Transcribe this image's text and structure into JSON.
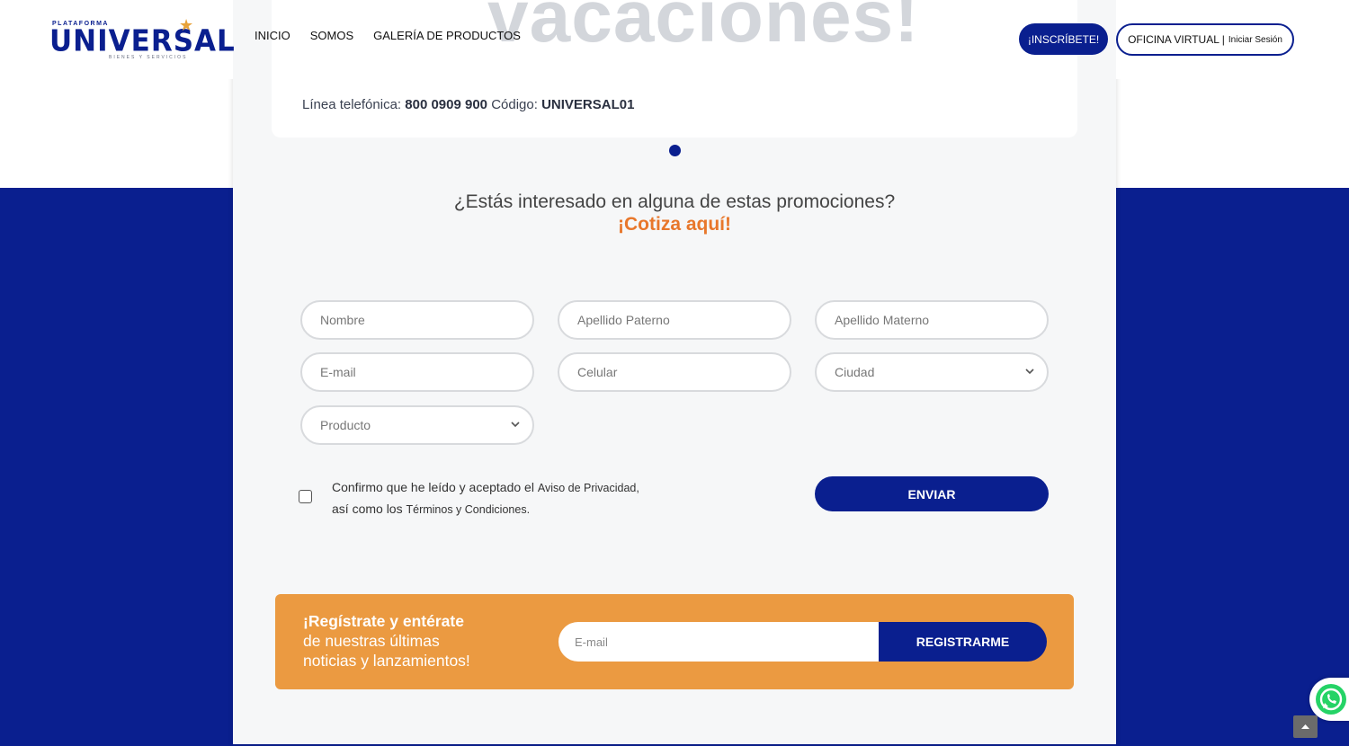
{
  "header": {
    "logo_top": "PLATAFORMA",
    "logo_main": "UNIVERSAL",
    "logo_sub": "BIENES Y SERVICIOS",
    "nav": [
      "INICIO",
      "SOMOS",
      "GALERÍA DE PRODUCTOS"
    ],
    "inscribete": "¡INSCRÍBETE!",
    "oficina": "OFICINA VIRTUAL |",
    "iniciar": "Iniciar Sesión"
  },
  "promo": {
    "big_text": "vacaciones!",
    "phone_label": "Línea telefónica:",
    "phone": "800 0909 900",
    "code_label": "Código:",
    "code": "UNIVERSAL01"
  },
  "quote": {
    "title": "¿Estás interesado en alguna de estas promociones?",
    "subtitle": "¡Cotiza aquí!"
  },
  "form": {
    "nombre": "Nombre",
    "apellido_paterno": "Apellido Paterno",
    "apellido_materno": "Apellido Materno",
    "email": "E-mail",
    "celular": "Celular",
    "ciudad": "Ciudad",
    "producto": "Producto",
    "consent_1": "Confirmo que he leído y aceptado el",
    "consent_privacy": "Aviso de Privacidad,",
    "consent_2": "así como los",
    "consent_terms": "Términos y Condiciones.",
    "submit": "ENVIAR"
  },
  "newsletter": {
    "headline": "¡Regístrate y entérate",
    "line2": "de nuestras últimas",
    "line3": "noticias y lanzamientos!",
    "email_placeholder": "E-mail",
    "button": "REGISTRARME"
  },
  "colors": {
    "brand_blue": "#0a1f8f",
    "accent_orange": "#e8772b",
    "news_orange": "#eb9a41",
    "whatsapp_green": "#25d366"
  },
  "icons": [
    "star-icon",
    "chevron-down-icon",
    "whatsapp-icon",
    "arrow-up-icon"
  ]
}
